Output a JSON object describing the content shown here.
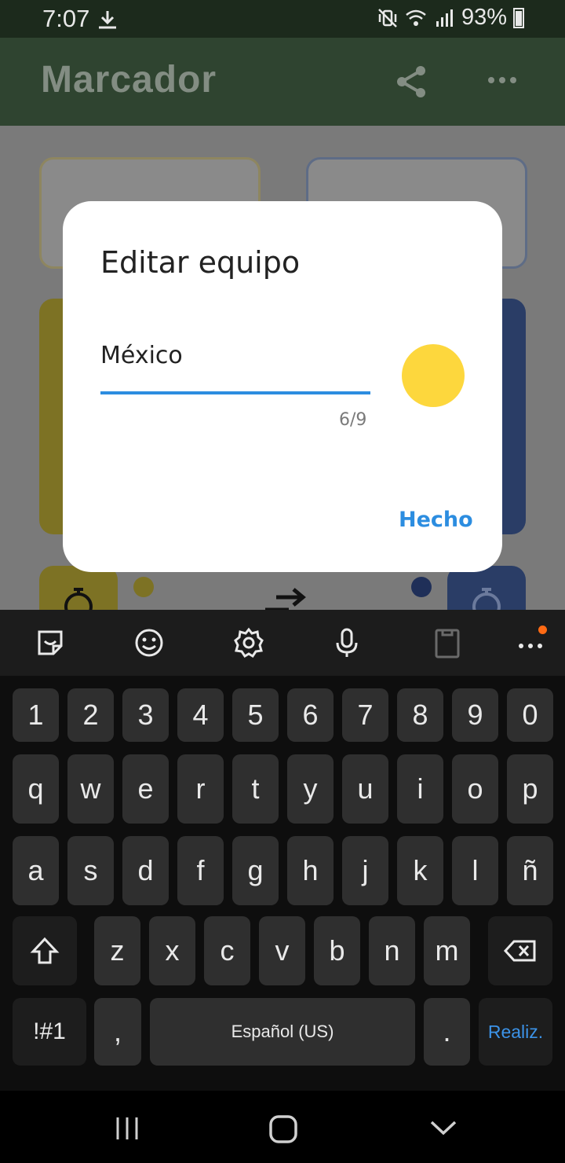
{
  "status_bar": {
    "time": "7:07",
    "battery": "93%"
  },
  "app_bar": {
    "title": "Marcador",
    "share_icon": "share-icon",
    "more_icon": "more-icon"
  },
  "dialog": {
    "title": "Editar equipo",
    "team_name": "México",
    "counter": "6/9",
    "color": "#fdd73d",
    "done_label": "Hecho"
  },
  "keyboard": {
    "row_numbers": [
      "1",
      "2",
      "3",
      "4",
      "5",
      "6",
      "7",
      "8",
      "9",
      "0"
    ],
    "row1": [
      "q",
      "w",
      "e",
      "r",
      "t",
      "y",
      "u",
      "i",
      "o",
      "p"
    ],
    "row2": [
      "a",
      "s",
      "d",
      "f",
      "g",
      "h",
      "j",
      "k",
      "l",
      "ñ"
    ],
    "row3": [
      "z",
      "x",
      "c",
      "v",
      "b",
      "n",
      "m"
    ],
    "symbols_label": "!#1",
    "comma_label": ",",
    "space_label": "Español (US)",
    "period_label": ".",
    "action_label": "Realiz."
  },
  "colors": {
    "accent": "#2c8de0",
    "team_yellow": "#fdd73d",
    "team_blue": "#2a4e9c"
  }
}
